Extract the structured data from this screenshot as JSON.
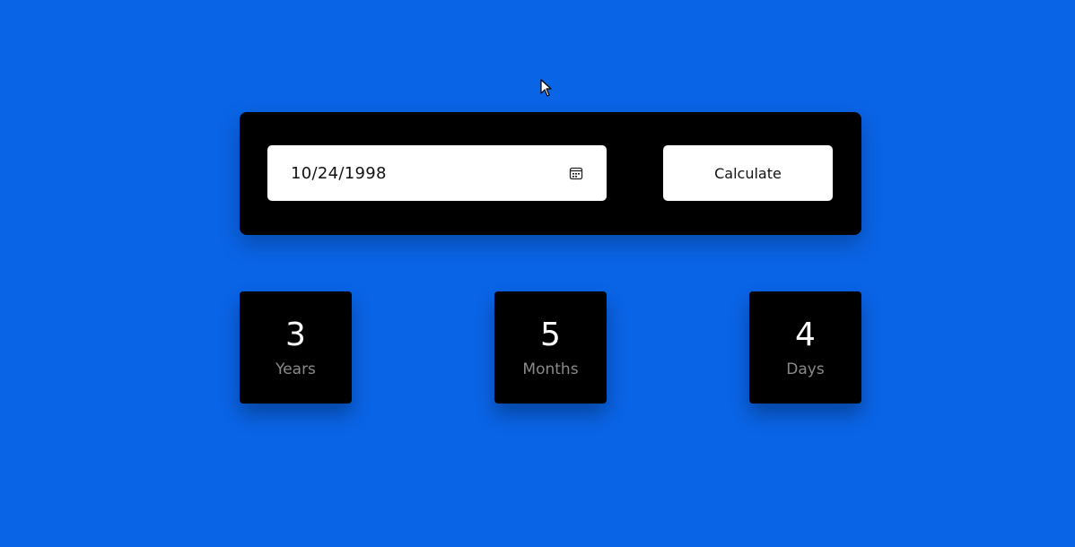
{
  "date_input": {
    "value": "10/24/1998",
    "icon": "calendar-icon"
  },
  "calculate_button": {
    "label": "Calculate"
  },
  "results": {
    "years": {
      "value": "3",
      "label": "Years"
    },
    "months": {
      "value": "5",
      "label": "Months"
    },
    "days": {
      "value": "4",
      "label": "Days"
    }
  },
  "colors": {
    "background": "#0a64e6",
    "panel": "#000000",
    "card_label": "#8a8a8a"
  }
}
